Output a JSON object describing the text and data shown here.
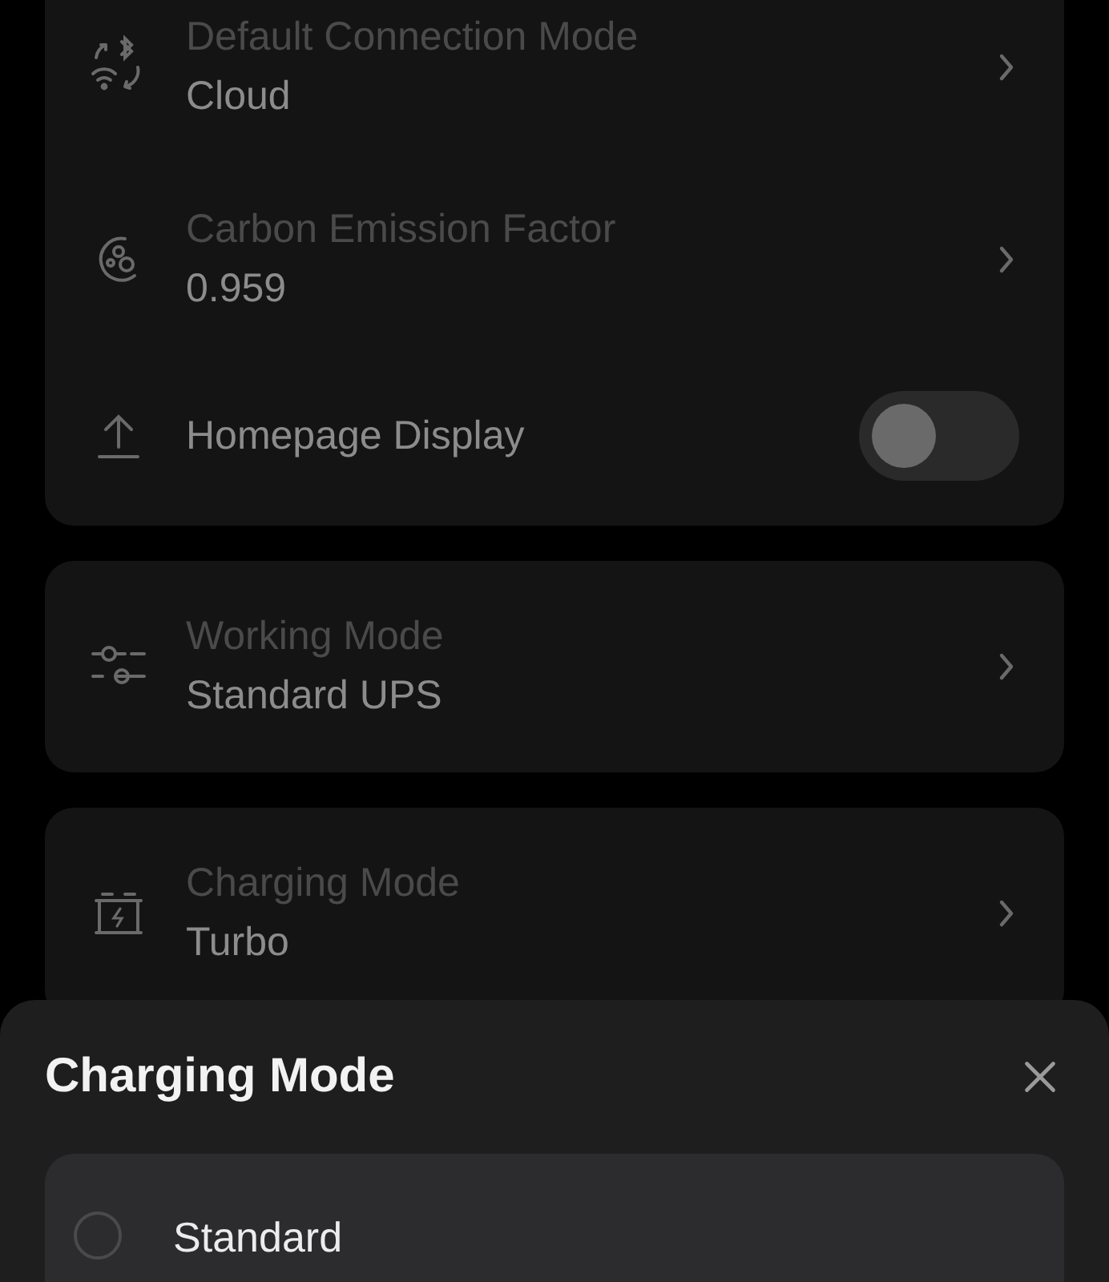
{
  "sections": [
    {
      "rows": [
        {
          "kind": "nav",
          "label": "Default Connection Mode",
          "value": "Cloud"
        },
        {
          "kind": "nav",
          "label": "Carbon Emission Factor",
          "value": "0.959"
        },
        {
          "kind": "toggle",
          "label": "Homepage Display",
          "on": false
        }
      ]
    },
    {
      "rows": [
        {
          "kind": "nav",
          "label": "Working Mode",
          "value": "Standard UPS"
        }
      ]
    },
    {
      "rows": [
        {
          "kind": "nav",
          "label": "Charging Mode",
          "value": "Turbo"
        }
      ]
    }
  ],
  "sheet": {
    "title": "Charging Mode",
    "options": [
      {
        "label": "Standard",
        "selected": false
      }
    ]
  }
}
